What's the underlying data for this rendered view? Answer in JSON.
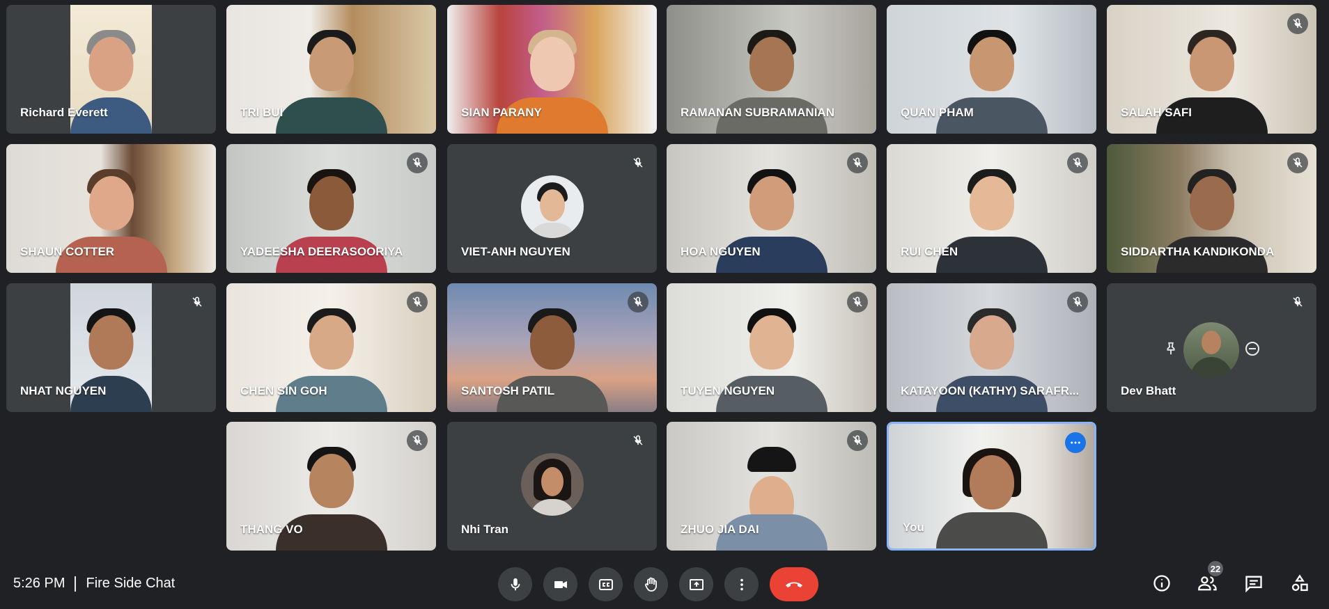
{
  "participants": [
    {
      "name": "Richard Everett"
    },
    {
      "name": "TRI BUI"
    },
    {
      "name": "SIAN PARANY"
    },
    {
      "name": "RAMANAN SUBRAMANIAN"
    },
    {
      "name": "QUAN PHAM"
    },
    {
      "name": "SALAH SAFI"
    },
    {
      "name": "SHAUN COTTER"
    },
    {
      "name": "YADEESHA DEERASOORIYA"
    },
    {
      "name": "VIET-ANH NGUYEN"
    },
    {
      "name": "HOA NGUYEN"
    },
    {
      "name": "RUI CHEN"
    },
    {
      "name": "SIDDARTHA KANDIKONDA"
    },
    {
      "name": "NHAT NGUYEN"
    },
    {
      "name": "CHEN SIN GOH"
    },
    {
      "name": "SANTOSH PATIL"
    },
    {
      "name": "TUYEN NGUYEN"
    },
    {
      "name": "KATAYOON (KATHY) SARAFR..."
    },
    {
      "name": "Dev Bhatt"
    },
    {
      "name": "THANG VO"
    },
    {
      "name": "Nhi Tran"
    },
    {
      "name": "ZHUO JIA DAI"
    },
    {
      "name": "You"
    }
  ],
  "meeting": {
    "time": "5:26 PM",
    "title": "Fire Side Chat"
  },
  "people_count": "22",
  "controls": {
    "mic": "microphone-icon",
    "camera": "camera-icon",
    "captions": "captions-icon",
    "raise_hand": "hand-icon",
    "present": "present-icon",
    "more": "more-vert-icon",
    "leave": "end-call-icon"
  },
  "colors": {
    "background": "#202124",
    "tile": "#3c4043",
    "end_call": "#ea4335",
    "self_border": "#8ab4f8",
    "accent": "#1a73e8"
  }
}
